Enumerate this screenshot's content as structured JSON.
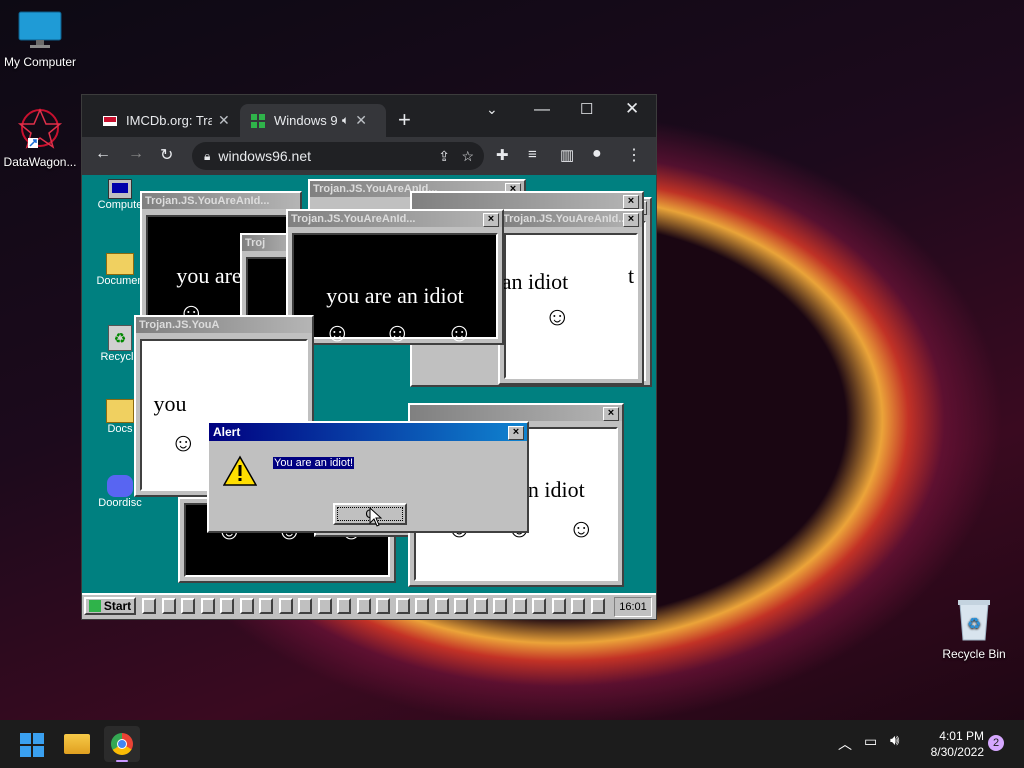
{
  "desktop": {
    "icons": [
      {
        "label": "My Computer",
        "icon": "monitor-icon"
      },
      {
        "label": "DataWagon...",
        "icon": "datawagon-icon"
      },
      {
        "label": "Recycle Bin",
        "icon": "recycle-bin-icon"
      }
    ]
  },
  "browser": {
    "tabs": [
      {
        "title": "IMCDb.org: Tra",
        "icon": "imcdb-favicon"
      },
      {
        "title": "Windows 9",
        "icon": "windows96-favicon",
        "audio": true
      }
    ],
    "new_tab_label": "+",
    "url": "windows96.net",
    "window_controls": [
      "chevron-down-icon",
      "minimize-icon",
      "maximize-icon",
      "close-icon"
    ]
  },
  "win96": {
    "desktop_icons": [
      {
        "label": "Compute"
      },
      {
        "label": "Documen"
      },
      {
        "label": "Recycle"
      },
      {
        "label": "Docs"
      },
      {
        "label": "Doordisc"
      }
    ],
    "popup_title": "Trojan.JS.YouAreAnId...",
    "popup_title_short": "Trojan.JS.YouA",
    "popup_title_tiny": "Troj",
    "idiot_text": "you are an idiot",
    "idiot_text_partial_1": "you are",
    "idiot_text_partial_2": "an idiot",
    "idiot_text_partial_3": "you",
    "idiot_text_partial_4": "y",
    "idiot_text_partial_5": "t",
    "smiley": "☺",
    "alert": {
      "title": "Alert",
      "message": "You are an idiot!",
      "ok_label": "O"
    },
    "taskbar": {
      "start_label": "Start",
      "clock": "16:01",
      "slot_count": 24
    }
  },
  "taskbar11": {
    "time": "4:01 PM",
    "date": "8/30/2022",
    "notification_count": "2",
    "pinned": [
      "windows-start-icon",
      "file-explorer-icon",
      "chrome-icon"
    ]
  },
  "colors": {
    "win96_teal": "#008080",
    "win96_gray": "#c0c0c0",
    "title_active": "#000080",
    "chrome_dark": "#202124"
  }
}
